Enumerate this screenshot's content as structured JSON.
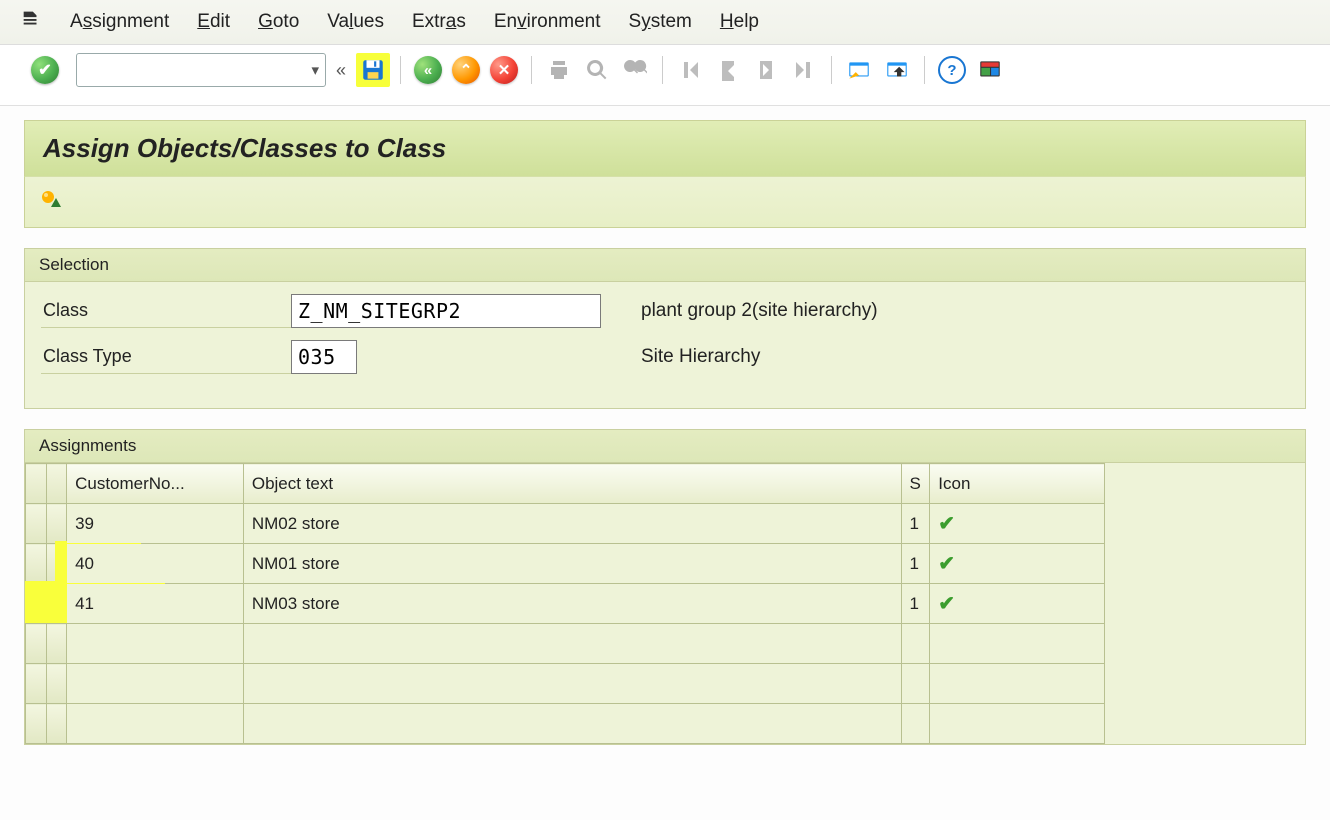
{
  "menu": {
    "assignment": "Assignment",
    "edit": "Edit",
    "goto": "Goto",
    "values": "Values",
    "extras": "Extras",
    "environment": "Environment",
    "system": "System",
    "help": "Help"
  },
  "toolbar": {
    "chev": "«"
  },
  "title": "Assign Objects/Classes to Class",
  "selection": {
    "group_label": "Selection",
    "class_label": "Class",
    "class_value": "Z_NM_SITEGRP2",
    "class_desc": "plant group 2(site hierarchy)",
    "classtype_label": "Class Type",
    "classtype_value": "035",
    "classtype_desc": "Site Hierarchy"
  },
  "assignments": {
    "group_label": "Assignments",
    "headers": {
      "cust": "CustomerNo...",
      "obj": "Object text",
      "s": "S",
      "icon": "Icon"
    },
    "rows": [
      {
        "cust": "39",
        "obj": "NM02 store",
        "s": "1",
        "ok": true
      },
      {
        "cust": "40",
        "obj": "NM01 store",
        "s": "1",
        "ok": true
      },
      {
        "cust": "41",
        "obj": "NM03 store",
        "s": "1",
        "ok": true
      }
    ]
  }
}
